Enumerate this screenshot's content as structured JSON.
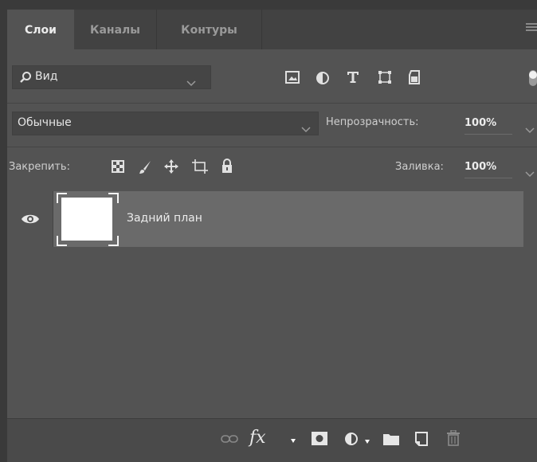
{
  "tabs": [
    {
      "label": "Слои",
      "active": true
    },
    {
      "label": "Каналы",
      "active": false
    },
    {
      "label": "Контуры",
      "active": false
    }
  ],
  "filter": {
    "label": "Вид",
    "icons": [
      "image-filter-icon",
      "adjustment-filter-icon",
      "type-filter-icon",
      "shape-filter-icon",
      "smart-object-filter-icon"
    ]
  },
  "blend": {
    "mode": "Обычные",
    "opacity_label": "Непрозрачность:",
    "opacity_value": "100%"
  },
  "lock": {
    "label": "Закрепить:",
    "fill_label": "Заливка:",
    "fill_value": "100%"
  },
  "layers": [
    {
      "name": "Задний план",
      "visible": true
    }
  ],
  "bottom_icons": [
    "link-layers-icon",
    "fx-icon",
    "add-mask-icon",
    "adjustment-layer-icon",
    "new-group-icon",
    "new-layer-icon",
    "delete-layer-icon"
  ],
  "bottom_fx_text": "fx",
  "colors": {
    "panel_bg": "#535353",
    "tab_bar_bg": "#424242",
    "selected_layer_bg": "#6a6a6a",
    "text": "#d6d6d6"
  }
}
